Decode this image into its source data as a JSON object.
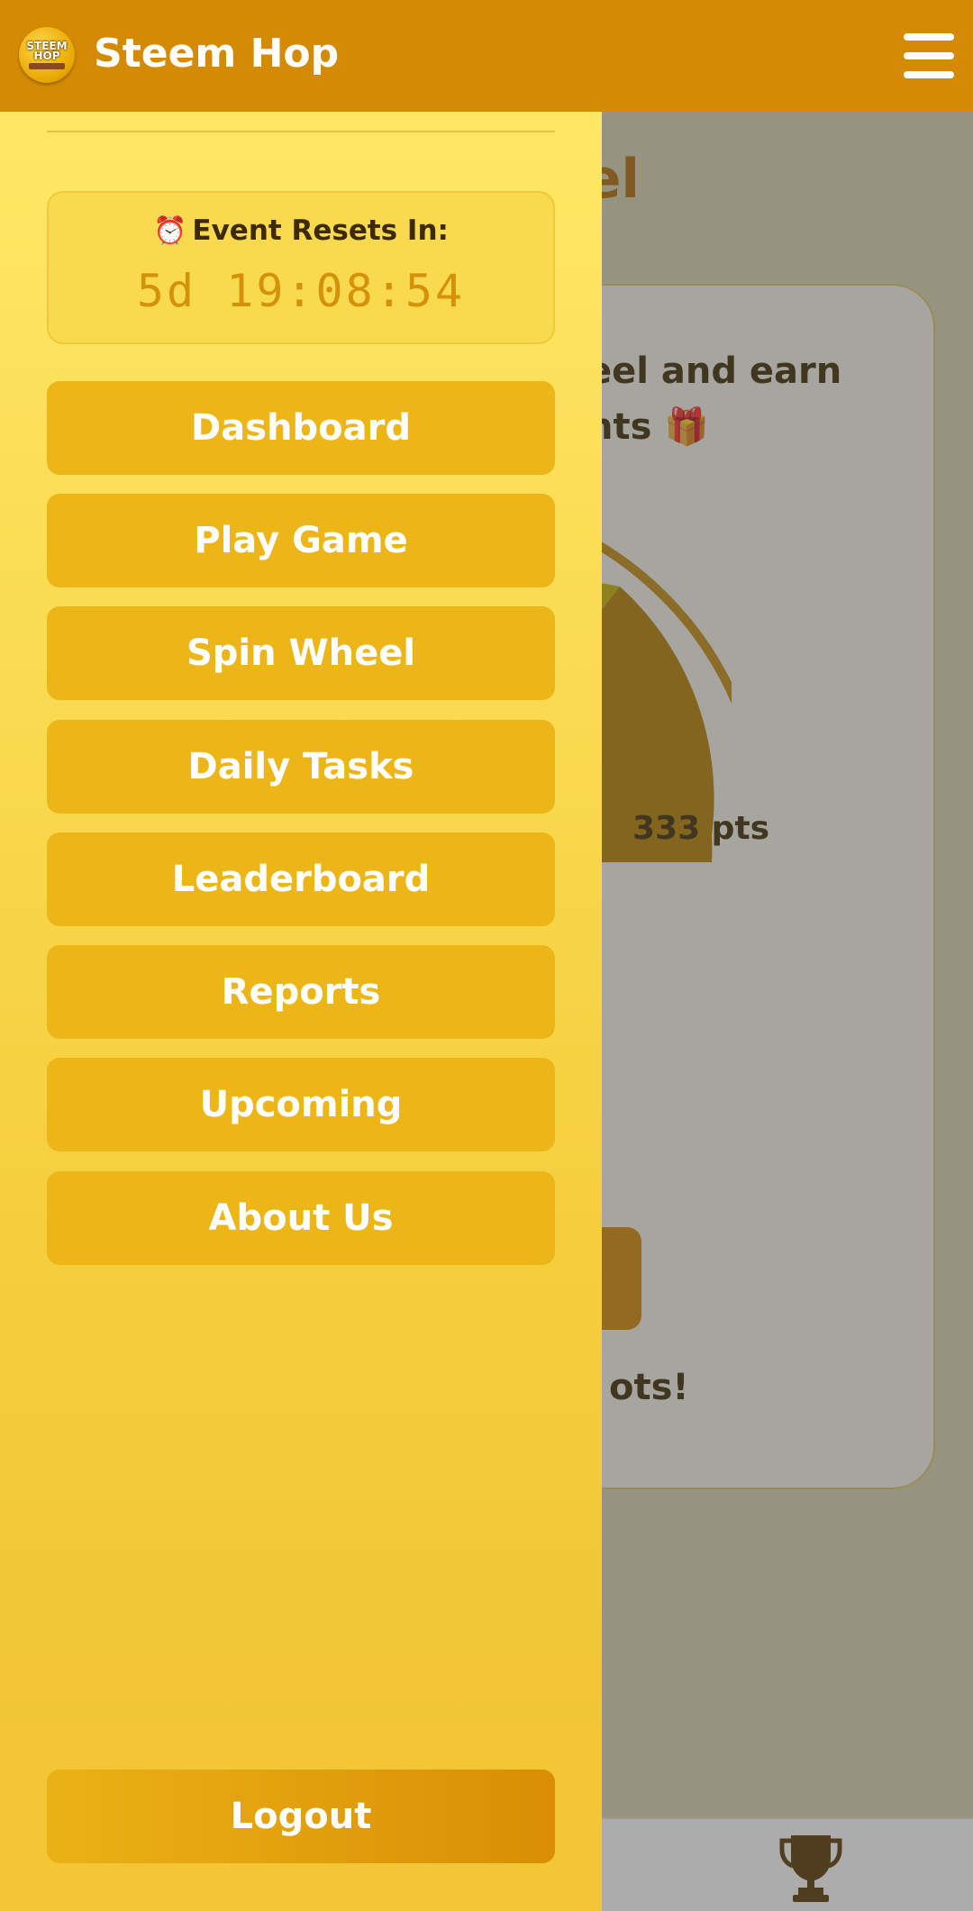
{
  "header": {
    "logo_text_line1": "STEEM",
    "logo_text_line2": "HOP",
    "title": "Steem Hop",
    "menu_icon": "hamburger-menu-icon"
  },
  "background_page": {
    "title_fragment": "el",
    "card_text_line1": "eel and earn",
    "card_text_line2": "nts 🎁",
    "wheel_segment_label": "333 pts",
    "footer_fragment": "ots!",
    "bottom_nav_icon": "trophy-icon"
  },
  "drawer": {
    "timer": {
      "icon": "alarm-clock-icon",
      "label": "Event Resets In:",
      "value": "5d 19:08:54"
    },
    "nav_items": [
      {
        "label": "Dashboard"
      },
      {
        "label": "Play Game"
      },
      {
        "label": "Spin Wheel"
      },
      {
        "label": "Daily Tasks"
      },
      {
        "label": "Leaderboard"
      },
      {
        "label": "Reports"
      },
      {
        "label": "Upcoming"
      },
      {
        "label": "About Us"
      }
    ],
    "logout_label": "Logout"
  },
  "colors": {
    "header_bg": "#d48a02",
    "drawer_top": "#ffe766",
    "drawer_bottom": "#f0c232",
    "nav_button": "#ecb619",
    "timer_value": "#d3920a"
  }
}
